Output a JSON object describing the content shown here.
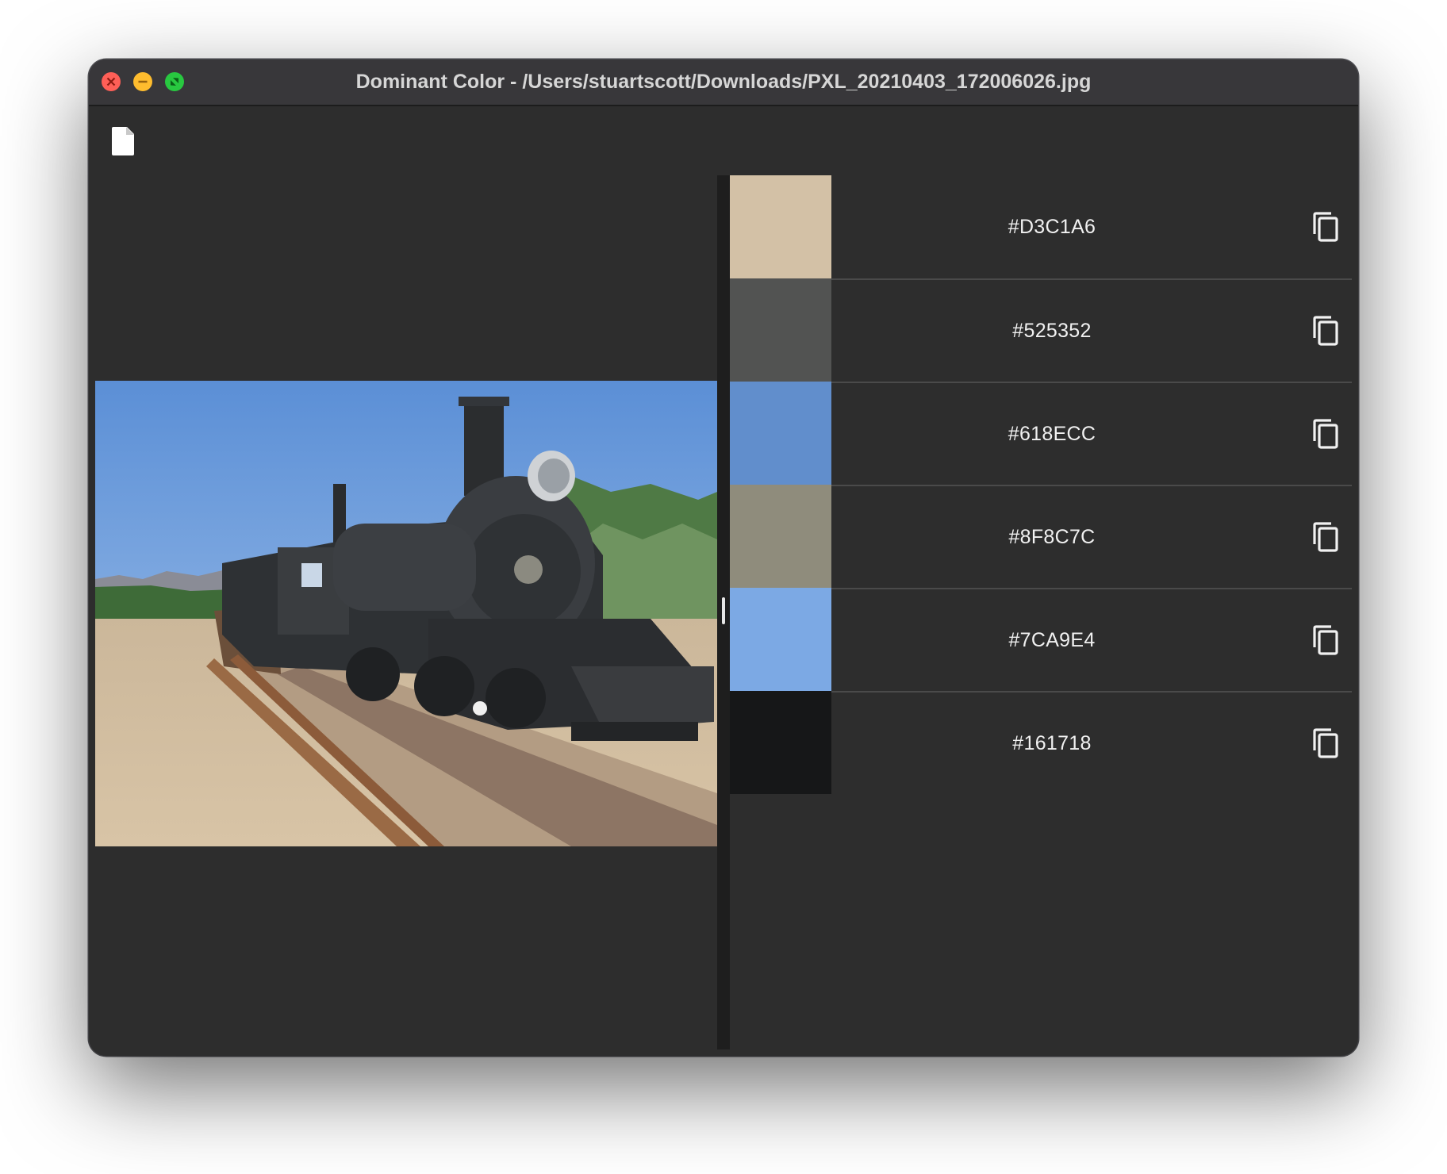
{
  "window": {
    "title": "Dominant Color - /Users/stuartscott/Downloads/PXL_20210403_172006026.jpg"
  },
  "toolbar": {
    "open_icon": "file-icon"
  },
  "colors": [
    {
      "hex": "#D3C1A6",
      "color": "#D3C1A6"
    },
    {
      "hex": "#525352",
      "color": "#525352"
    },
    {
      "hex": "#618ECC",
      "color": "#618ECC"
    },
    {
      "hex": "#8F8C7C",
      "color": "#8F8C7C"
    },
    {
      "hex": "#7CA9E4",
      "color": "#7CA9E4"
    },
    {
      "hex": "#161718",
      "color": "#161718"
    }
  ],
  "icons": {
    "copy": "copy-icon"
  }
}
